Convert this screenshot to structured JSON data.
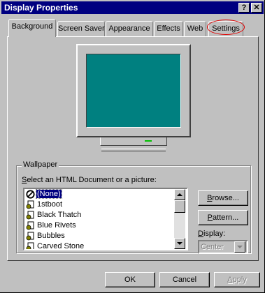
{
  "window": {
    "title": "Display Properties",
    "help_label": "?",
    "close_label": "✕"
  },
  "tabs": [
    {
      "label": "Background",
      "active": true
    },
    {
      "label": "Screen Saver",
      "active": false
    },
    {
      "label": "Appearance",
      "active": false
    },
    {
      "label": "Effects",
      "active": false
    },
    {
      "label": "Web",
      "active": false
    },
    {
      "label": "Settings",
      "active": false
    }
  ],
  "background": {
    "monitor": {
      "screen_color": "#008080"
    },
    "wallpaper": {
      "group_label": "Wallpaper",
      "select_label_underlined": "S",
      "select_label_rest": "elect an HTML Document or a picture:",
      "items": [
        {
          "label": "(None)",
          "icon": "none-icon",
          "selected": true
        },
        {
          "label": "1stboot",
          "icon": "html-document-icon",
          "selected": false
        },
        {
          "label": "Black Thatch",
          "icon": "html-document-icon",
          "selected": false
        },
        {
          "label": "Blue Rivets",
          "icon": "html-document-icon",
          "selected": false
        },
        {
          "label": "Bubbles",
          "icon": "html-document-icon",
          "selected": false
        },
        {
          "label": "Carved Stone",
          "icon": "html-document-icon",
          "selected": false
        }
      ],
      "browse_button": {
        "underlined": "B",
        "rest": "rowse..."
      },
      "pattern_button": {
        "underlined": "P",
        "rest": "attern..."
      },
      "display": {
        "label_underlined": "D",
        "label_rest": "isplay:",
        "value": "Center",
        "enabled": false
      }
    }
  },
  "footer": {
    "ok_label": "OK",
    "cancel_label": "Cancel",
    "apply_label_underlined": "A",
    "apply_label_rest": "pply",
    "apply_enabled": false
  },
  "colors": {
    "titlebar": "#000080",
    "face": "#c0c0c0",
    "selection": "#000080",
    "highlight_circle": "#e00000"
  }
}
